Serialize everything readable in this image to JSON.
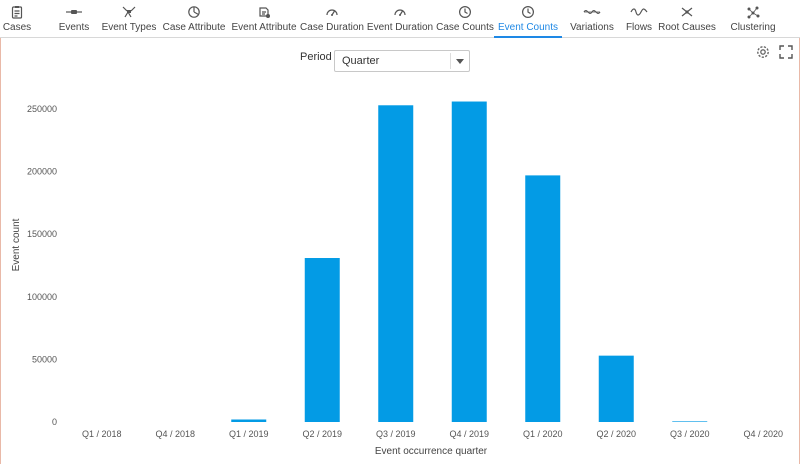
{
  "tabs": [
    {
      "label": "Cases",
      "icon": "clipboard-icon"
    },
    {
      "label": "Events",
      "icon": "events-icon"
    },
    {
      "label": "Event Types",
      "icon": "event-types-icon"
    },
    {
      "label": "Case Attribute",
      "icon": "pie-icon"
    },
    {
      "label": "Event Attribute",
      "icon": "event-attribute-icon"
    },
    {
      "label": "Case Duration",
      "icon": "gauge-icon"
    },
    {
      "label": "Event Duration",
      "icon": "gauge-icon"
    },
    {
      "label": "Case Counts",
      "icon": "clock-icon"
    },
    {
      "label": "Event Counts",
      "icon": "clock-icon",
      "active": true
    },
    {
      "label": "Variations",
      "icon": "variations-icon"
    },
    {
      "label": "Flows",
      "icon": "flows-icon"
    },
    {
      "label": "Root Causes",
      "icon": "root-causes-icon"
    },
    {
      "label": "Clustering",
      "icon": "clustering-icon"
    }
  ],
  "period": {
    "label": "Period",
    "value": "Quarter"
  },
  "colors": {
    "bar": "#039be5",
    "active_tab": "#1e88e5"
  },
  "chart_data": {
    "type": "bar",
    "categories": [
      "Q1 / 2018",
      "Q4 / 2018",
      "Q1 / 2019",
      "Q2 / 2019",
      "Q3 / 2019",
      "Q4 / 2019",
      "Q1 / 2020",
      "Q2 / 2020",
      "Q3 / 2020",
      "Q4 / 2020"
    ],
    "values": [
      0,
      0,
      2000,
      131000,
      253000,
      256000,
      197000,
      53000,
      500,
      0
    ],
    "xlabel": "Event occurrence quarter",
    "ylabel": "Event count",
    "ylim": [
      0,
      270000
    ],
    "yticks": [
      0,
      50000,
      100000,
      150000,
      200000,
      250000
    ],
    "grid": false,
    "legend": "none"
  }
}
